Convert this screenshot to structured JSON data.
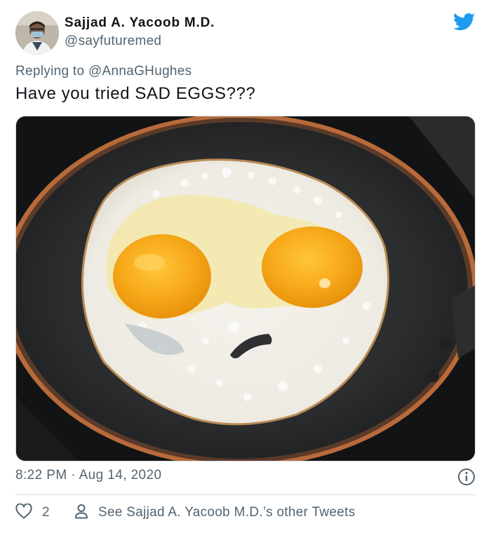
{
  "author": {
    "name": "Sajjad A. Yacoob M.D.",
    "handle": "@sayfuturemed"
  },
  "reply": {
    "prefix": "Replying to ",
    "mention": "@AnnaGHughes"
  },
  "tweet": {
    "text": "Have you tried SAD EGGS???",
    "timestamp": "8:22 PM · Aug 14, 2020",
    "media_description_icon": "fried-egg-sad-face-photo"
  },
  "actions": {
    "like_count": "2",
    "other_tweets_label": "See Sajjad A. Yacoob M.D.’s other Tweets"
  },
  "icons": {
    "brand": "twitter-bird-icon",
    "info": "info-icon",
    "like": "heart-icon",
    "profile": "person-icon"
  },
  "colors": {
    "twitter_blue": "#1d9bf0",
    "text_primary": "#0f1419",
    "text_secondary": "#536471",
    "border": "#cfd9de"
  }
}
